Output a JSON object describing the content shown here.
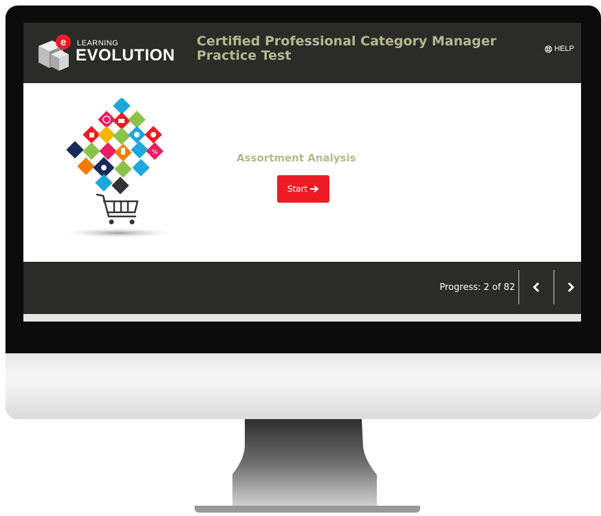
{
  "header": {
    "logo_small": "LEARNING",
    "logo_big": "EVOLUTION",
    "title": "Certified Professional Category Manager Practice Test",
    "help_label": "HELP"
  },
  "content": {
    "lesson_title": "Assortment Analysis",
    "start_label": "Start"
  },
  "footer": {
    "progress_text": "Progress: 2 of 82",
    "progress_current": 2,
    "progress_total": 82
  },
  "colors": {
    "bar": "#2b2b28",
    "title_olive": "#b3b98c",
    "start_red": "#ed1c24"
  }
}
